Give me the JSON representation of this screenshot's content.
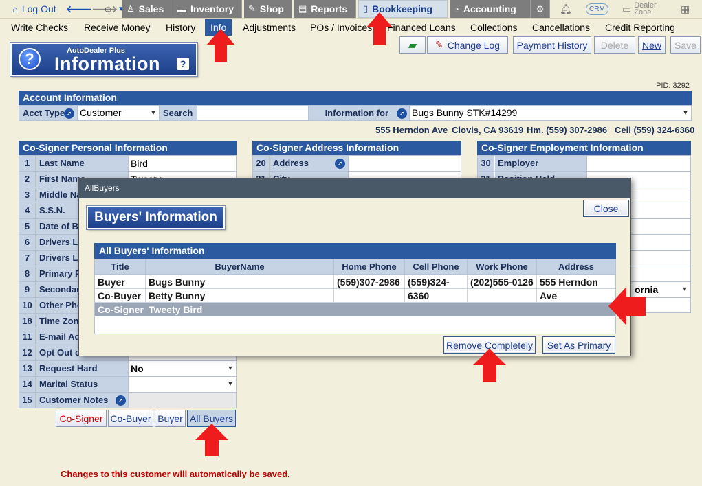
{
  "topnav": {
    "logout": "Log Out",
    "sales": "Sales",
    "inventory": "Inventory",
    "shop": "Shop",
    "reports": "Reports",
    "bookkeeping": "Bookkeeping",
    "accounting": "Accounting",
    "crm": "CRM",
    "dealer_zone": "Dealer Zone"
  },
  "subnav": {
    "items": [
      "Write Checks",
      "Receive Money",
      "History",
      "Info",
      "Adjustments",
      "POs / Invoices",
      "Financed Loans",
      "Collections",
      "Cancellations",
      "Credit Reporting"
    ],
    "active": "Info"
  },
  "banner": {
    "sub": "AutoDealer Plus",
    "title": "Information",
    "help": "?"
  },
  "toolbar": {
    "change_log": "Change Log",
    "payment_history": "Payment History",
    "delete": "Delete",
    "new": "New",
    "save": "Save"
  },
  "pid": "PID: 3292",
  "account": {
    "header": "Account Information",
    "acct_type_label": "Acct Type",
    "acct_type_value": "Customer",
    "search_label": "Search",
    "search_value": "",
    "info_for_label": "Information for",
    "info_for_value": "Bugs Bunny STK#14299",
    "address": "555 Herndon Ave",
    "city": "Clovis, CA 93619",
    "home_phone": "Hm. (559) 307-2986",
    "cell_phone": "Cell (559) 324-6360"
  },
  "personal": {
    "header": "Co-Signer Personal Information",
    "rows": [
      {
        "num": "1",
        "label": "Last Name",
        "value": "Bird"
      },
      {
        "num": "2",
        "label": "First Name",
        "value": "Tweety"
      },
      {
        "num": "3",
        "label": "Middle Name",
        "value": ""
      },
      {
        "num": "4",
        "label": "S.S.N.",
        "value": ""
      },
      {
        "num": "5",
        "label": "Date of Birth",
        "value": ""
      },
      {
        "num": "6",
        "label": "Drivers License",
        "value": ""
      },
      {
        "num": "7",
        "label": "Drivers License",
        "value": ""
      },
      {
        "num": "8",
        "label": "Primary Phone",
        "value": ""
      },
      {
        "num": "9",
        "label": "Secondary Phone",
        "value": ""
      },
      {
        "num": "10",
        "label": "Other Phone",
        "value": ""
      },
      {
        "num": "18",
        "label": "Time Zone",
        "value": ""
      },
      {
        "num": "11",
        "label": "E-mail Address",
        "value": ""
      },
      {
        "num": "12",
        "label": "Opt Out of",
        "value": ""
      },
      {
        "num": "13",
        "label": "Request Hard Copies",
        "value": "No"
      },
      {
        "num": "14",
        "label": "Marital Status",
        "value": ""
      },
      {
        "num": "15",
        "label": "Customer Notes",
        "value": ""
      }
    ]
  },
  "address_info": {
    "header": "Co-Signer Address Information",
    "rows": [
      {
        "num": "20",
        "label": "Address",
        "value": ""
      },
      {
        "num": "21",
        "label": "City",
        "value": ""
      }
    ]
  },
  "employment": {
    "header": "Co-Signer Employment Information",
    "rows": [
      {
        "num": "30",
        "label": "Employer",
        "value": ""
      },
      {
        "num": "31",
        "label": "Position Held",
        "value": ""
      }
    ],
    "state_value": "ornia"
  },
  "bottom_buttons": {
    "co_signer": "Co-Signer",
    "co_buyer": "Co-Buyer",
    "buyer": "Buyer",
    "all_buyers": "All Buyers"
  },
  "note": "Changes to this customer will automatically be saved.",
  "modal": {
    "title": "AllBuyers",
    "close": "Close",
    "banner": "Buyers' Information",
    "table_header": "All Buyers' Information",
    "columns": [
      "Title",
      "BuyerName",
      "Home Phone",
      "Cell Phone",
      "Work Phone",
      "Address"
    ],
    "rows": [
      {
        "title": "Buyer",
        "name": "Bugs Bunny",
        "home": "(559)307-2986",
        "cell": "(559)324-6360",
        "work": "(202)555-0126",
        "address": "555 Herndon Ave"
      },
      {
        "title": "Co-Buyer",
        "name": "Betty Bunny",
        "home": "",
        "cell": "",
        "work": "",
        "address": ""
      },
      {
        "title": "Co-Signer",
        "name": "Tweety Bird",
        "home": "",
        "cell": "",
        "work": "",
        "address": ""
      }
    ],
    "remove": "Remove Completely",
    "set_primary": "Set As Primary"
  },
  "colors": {
    "brand_blue": "#2c5aa0",
    "arrow_red": "#ee1c1c"
  }
}
